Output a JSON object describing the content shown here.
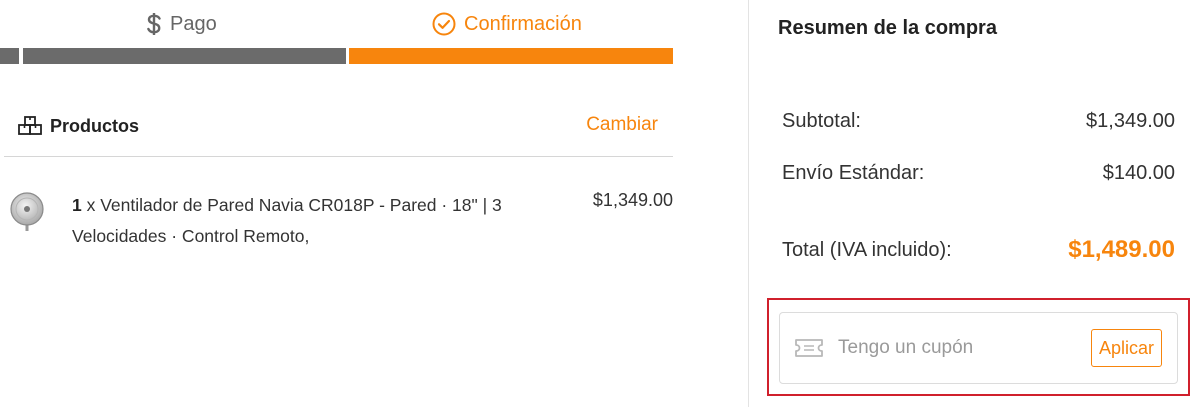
{
  "steps": {
    "pago": {
      "label": "Pago",
      "icon": "dollar-icon",
      "color": "#666666"
    },
    "confirmacion": {
      "label": "Confirmación",
      "icon": "check-circle-icon",
      "color": "#f7850d"
    }
  },
  "products": {
    "title": "Productos",
    "icon": "boxes-icon",
    "change_label": "Cambiar",
    "items": [
      {
        "quantity": "1",
        "quantity_sep": " x ",
        "description": "Ventilador de Pared Navia CR018P - Pared · 18\" | 3 Velocidades · Control Remoto,",
        "price": "$1,349.00",
        "thumb_icon": "fan-icon"
      }
    ]
  },
  "summary": {
    "title": "Resumen de la compra",
    "subtotal_label": "Subtotal:",
    "subtotal_value": "$1,349.00",
    "shipping_label": "Envío Estándar:",
    "shipping_value": "$140.00",
    "total_label": "Total (IVA incluido):",
    "total_value": "$1,489.00"
  },
  "coupon": {
    "icon": "ticket-icon",
    "placeholder": "Tengo un cupón",
    "value": "",
    "apply_label": "Aplicar"
  },
  "colors": {
    "accent": "#f7850d",
    "progress_inactive": "#6b6b6b",
    "highlight_border": "#d0202c"
  }
}
